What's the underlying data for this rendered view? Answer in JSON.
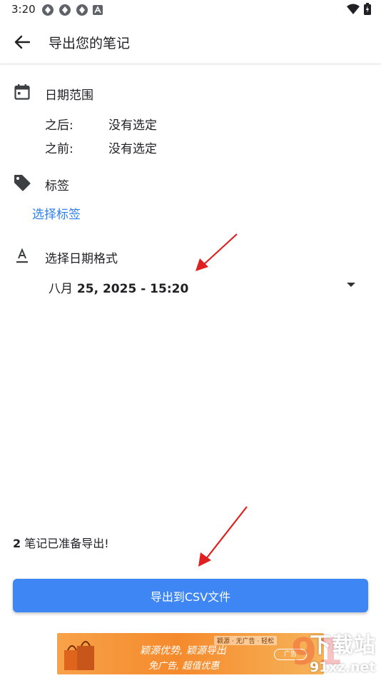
{
  "status_bar": {
    "time": "3:20"
  },
  "app_bar": {
    "title": "导出您的笔记"
  },
  "date_range": {
    "title": "日期范围",
    "after_label": "之后:",
    "after_value": "没有选定",
    "before_label": "之前:",
    "before_value": "没有选定"
  },
  "tags": {
    "title": "标签",
    "select_link": "选择标签"
  },
  "date_format": {
    "title": "选择日期格式",
    "selected_month": "八月",
    "selected_rest": "25, 2025 - 15:20"
  },
  "footer": {
    "ready_count": "2",
    "ready_text": "笔记已准备导出!",
    "export_button": "导出到CSV文件"
  },
  "ad": {
    "line1": "颖源优势, 颖源导出",
    "line2": "免广告, 超值优惠",
    "tags": "颖源 · 无广告 · 轻松",
    "close": "广告"
  },
  "watermark": {
    "number": "91",
    "name": "下载站",
    "url": "91xz.net"
  },
  "colors": {
    "accent": "#3d86f4",
    "link": "#2f80ed",
    "annotation_arrow": "#e02020"
  },
  "icons": {
    "back": "arrow-left-icon",
    "date_range": "calendar-icon",
    "tags": "tag-icon",
    "date_format": "text-format-icon",
    "dropdown": "caret-down-icon"
  }
}
